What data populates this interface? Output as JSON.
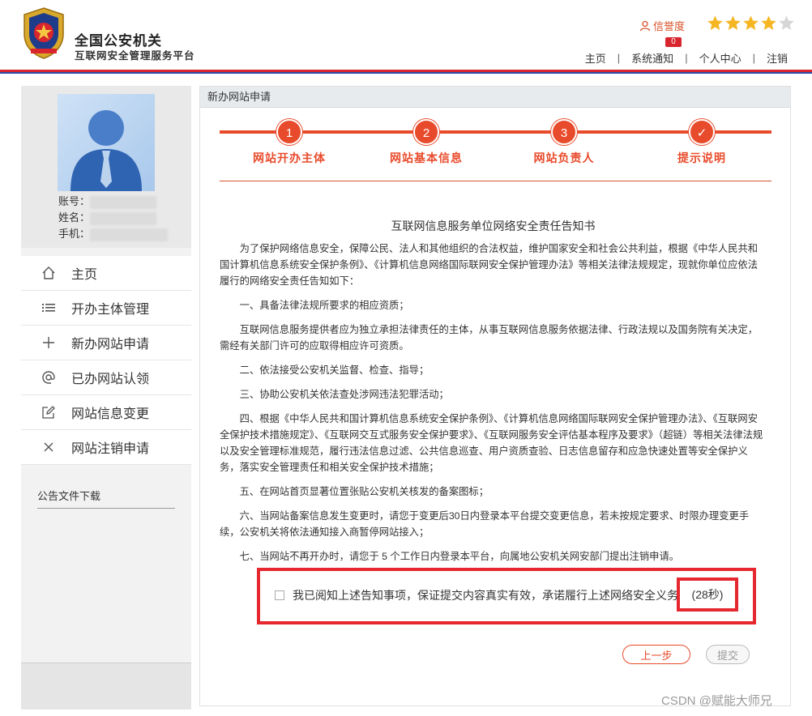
{
  "header": {
    "title": "全国公安机关",
    "subtitle": "互联网安全管理服务平台",
    "credit_label": "信誉度",
    "rating": 4,
    "rating_max": 5,
    "notice_count": "0",
    "nav": [
      "主页",
      "系统通知",
      "个人中心",
      "注销"
    ],
    "nav_sep": "|"
  },
  "profile": {
    "account_label": "账号：",
    "name_label": "姓名：",
    "phone_label": "手机："
  },
  "sidebar": {
    "items": [
      {
        "label": "主页",
        "icon": "home-icon"
      },
      {
        "label": "开办主体管理",
        "icon": "list-icon"
      },
      {
        "label": "新办网站申请",
        "icon": "plus-icon"
      },
      {
        "label": "已办网站认领",
        "icon": "at-icon"
      },
      {
        "label": "网站信息变更",
        "icon": "edit-icon"
      },
      {
        "label": "网站注销申请",
        "icon": "close-icon"
      }
    ],
    "downloads": "公告文件下载"
  },
  "main": {
    "header": "新办网站申请",
    "steps": [
      {
        "num": "1",
        "label": "网站开办主体"
      },
      {
        "num": "2",
        "label": "网站基本信息"
      },
      {
        "num": "3",
        "label": "网站负责人"
      },
      {
        "num": "✓",
        "label": "提示说明"
      }
    ],
    "doc_title": "互联网信息服务单位网络安全责任告知书",
    "paragraphs": [
      "为了保护网络信息安全，保障公民、法人和其他组织的合法权益，维护国家安全和社会公共利益，根据《中华人民共和国计算机信息系统安全保护条例》、《计算机信息网络国际联网安全保护管理办法》等相关法律法规规定，现就你单位应依法履行的网络安全责任告知如下：",
      "一、具备法律法规所要求的相应资质；",
      "互联网信息服务提供者应为独立承担法律责任的主体，从事互联网信息服务依据法律、行政法规以及国务院有关决定，需经有关部门许可的应取得相应许可资质。",
      "二、依法接受公安机关监督、检查、指导；",
      "三、协助公安机关依法查处涉网违法犯罪活动；",
      "四、根据《中华人民共和国计算机信息系统安全保护条例》、《计算机信息网络国际联网安全保护管理办法》、《互联网安全保护技术措施规定》、《互联网交互式服务安全保护要求》、《互联网服务安全评估基本程序及要求》（超链）等相关法律法规以及安全管理标准规范，履行违法信息过滤、公共信息巡查、用户资质查验、日志信息留存和应急快速处置等安全保护义务，落实安全管理责任和相关安全保护技术措施；",
      "五、在网站首页显著位置张贴公安机关核发的备案图标；",
      "六、当网站备案信息发生变更时，请您于变更后30日内登录本平台提交变更信息，若未按规定要求、时限办理变更手续，公安机关将依法通知接入商暂停网站接入；",
      "七、当网站不再开办时，请您于 5 个工作日内登录本平台，向属地公安机关网安部门提出注销申请。"
    ],
    "agree_text": "我已阅知上述告知事项，保证提交内容真实有效，承诺履行上述网络安全义务",
    "countdown": "(28秒)",
    "prev_button": "上一步",
    "submit_button": "提交"
  },
  "watermark": "CSDN @赋能大师兄",
  "colors": {
    "accent": "#e84b2c",
    "red_line": "#d9252e",
    "blue_line": "#2b4ea8",
    "star": "#f5b622",
    "highlight_border": "#e5282f"
  }
}
